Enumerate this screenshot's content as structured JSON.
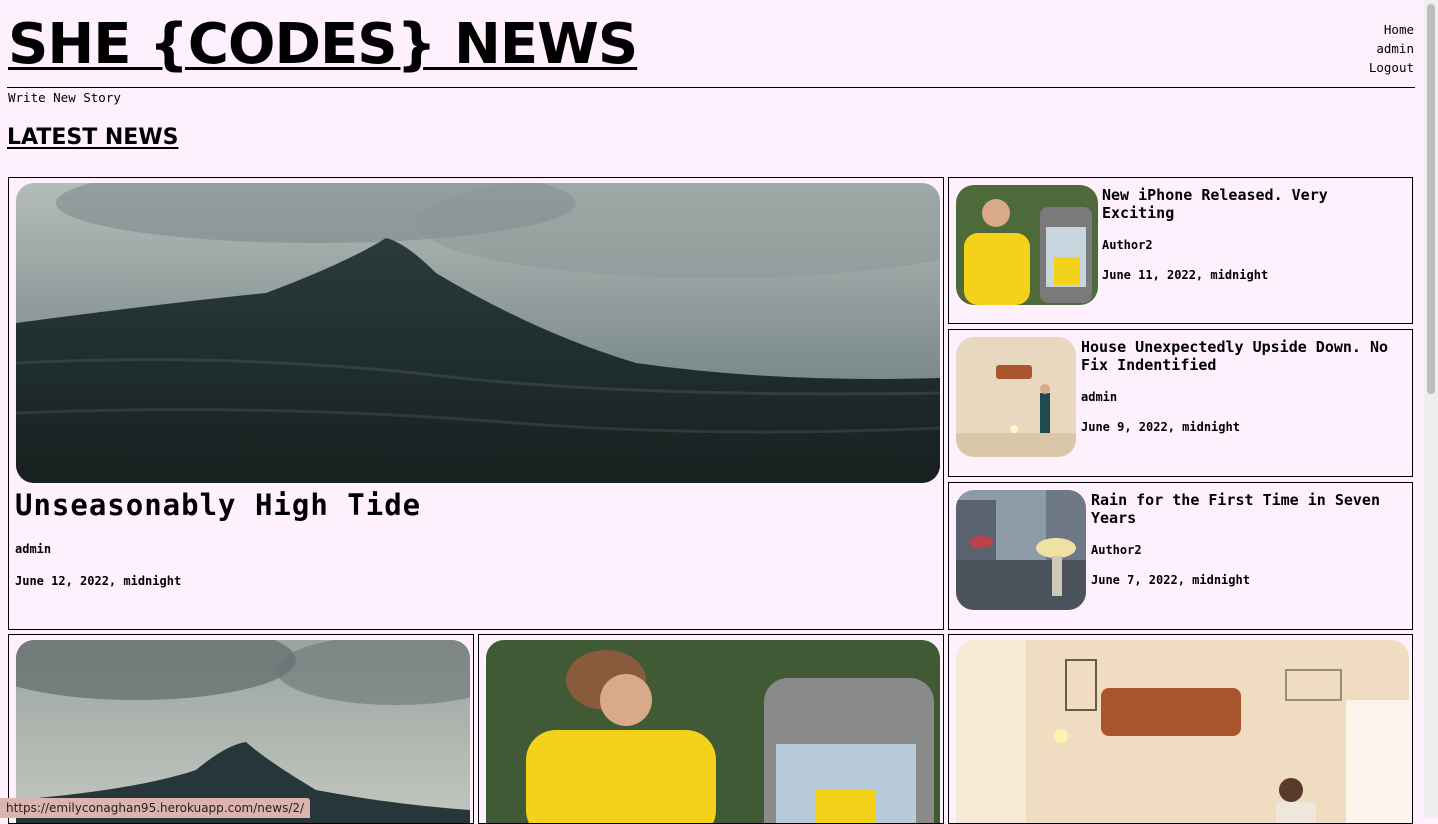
{
  "site": {
    "title": "SHE {CODES} NEWS"
  },
  "nav": {
    "items": [
      "Home",
      "admin",
      "Logout"
    ]
  },
  "write_link": "Write New Story",
  "section_title": "LATEST NEWS",
  "featured": {
    "title": "Unseasonably High Tide",
    "author": "admin",
    "date": "June 12, 2022, midnight",
    "image_icon": "ocean-wave-image"
  },
  "side_stories": [
    {
      "title": "New iPhone Released. Very Exciting",
      "author": "Author2",
      "date": "June 11, 2022, midnight",
      "image_icon": "yellow-sweater-phone-image"
    },
    {
      "title": "House Unexpectedly Upside Down. No Fix Indentified",
      "author": "admin",
      "date": "June 9, 2022, midnight",
      "image_icon": "upside-down-room-image"
    },
    {
      "title": "Rain for the First Time in Seven Years",
      "author": "Author2",
      "date": "June 7, 2022, midnight",
      "image_icon": "rainy-street-image"
    }
  ],
  "status_url": "https://emilyconaghan95.herokuapp.com/news/2/",
  "colors": {
    "background": "#fff0fe",
    "text": "#000000",
    "status_bar": "#dcb3ae"
  }
}
